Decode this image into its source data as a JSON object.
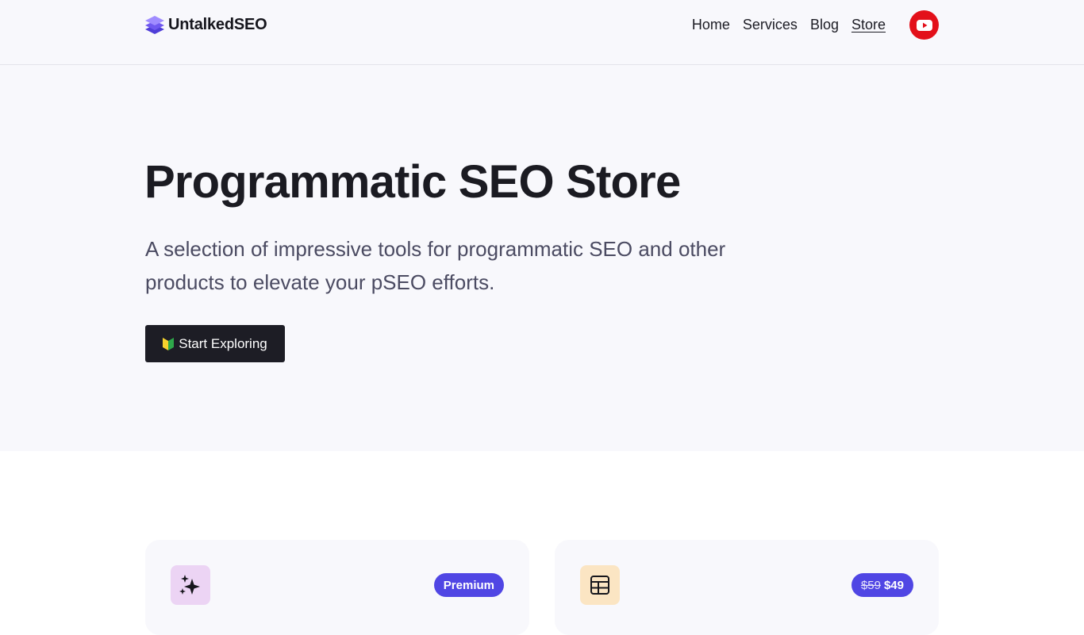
{
  "header": {
    "brand": "UntalkedSEO",
    "logo_icon": "stacked-layers-logo",
    "nav": [
      {
        "label": "Home",
        "active": false
      },
      {
        "label": "Services",
        "active": false
      },
      {
        "label": "Blog",
        "active": false
      },
      {
        "label": "Store",
        "active": true
      }
    ],
    "youtube_icon": "youtube-icon"
  },
  "hero": {
    "title": "Programmatic SEO Store",
    "subtitle": "A selection of impressive tools for programmatic SEO and other products to elevate your pSEO efforts.",
    "cta_label": "Start Exploring",
    "cta_icon": "beginner-leaf-icon"
  },
  "products": [
    {
      "icon": "sparkles-icon",
      "badge": "Premium"
    },
    {
      "icon": "table-layout-icon",
      "old_price": "$59",
      "price": "$49"
    }
  ],
  "colors": {
    "accent": "#5046e4",
    "cta_background": "#1d1d25",
    "youtube_red": "#e3101a",
    "page_tint": "#f8f8fc"
  }
}
